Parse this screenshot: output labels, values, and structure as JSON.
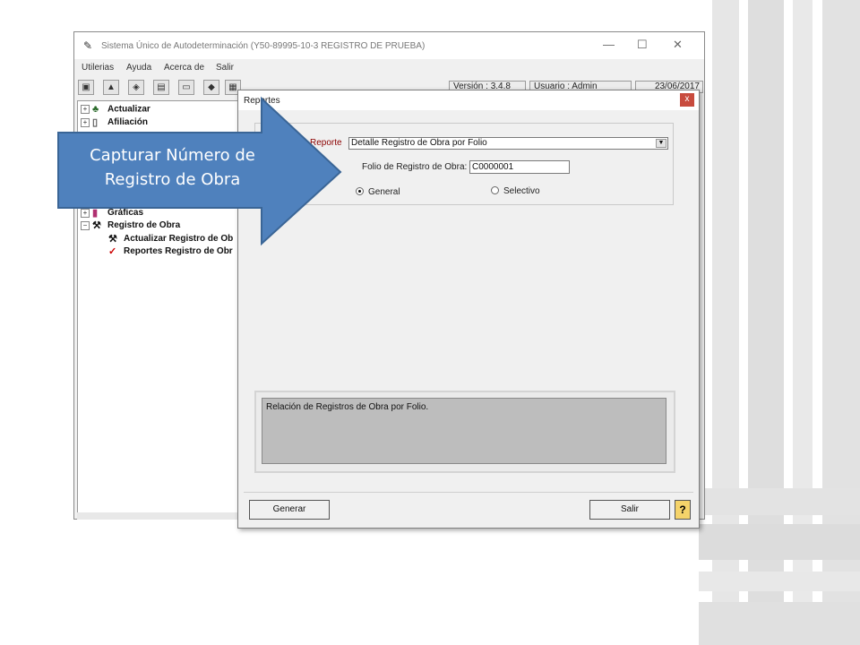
{
  "window": {
    "title": "Sistema Único de Autodeterminación (Y50-89995-10-3  REGISTRO DE PRUEBA)",
    "minimize_glyph": "—",
    "maximize_glyph": "☐",
    "close_glyph": "✕"
  },
  "menu": [
    "Utilerias",
    "Ayuda",
    "Acerca de",
    "Salir"
  ],
  "status": {
    "version": "Versión : 3.4.8",
    "user": "Usuario : Admin",
    "date": "23/06/2017"
  },
  "tree": {
    "items": [
      "Actualizar",
      "Afiliación",
      "Gráficas",
      "Registro de Obra"
    ],
    "children": [
      "Actualizar Registro de Ob",
      "Reportes Registro de Obr"
    ],
    "expander_plus": "+",
    "expander_minus": "−"
  },
  "dialog": {
    "title": "Reportes",
    "close_glyph": "x",
    "report_label": "Reporte",
    "report_selected": "Detalle Registro de Obra por Folio",
    "folio_label": "Folio de Registro de Obra:",
    "folio_value": "C0000001",
    "radio_general": "General",
    "radio_selectivo": "Selectivo",
    "description": "Relación de Registros de Obra por Folio.",
    "generate_button": "Generar",
    "exit_button": "Salir",
    "help_glyph": "?"
  },
  "callout": {
    "line1": "Capturar Número de",
    "line2": "Registro de Obra"
  },
  "colors": {
    "callout_fill": "#4f81bd",
    "callout_border": "#3a6596",
    "report_label": "#8b0000",
    "stripes": "#dcdcdc"
  }
}
